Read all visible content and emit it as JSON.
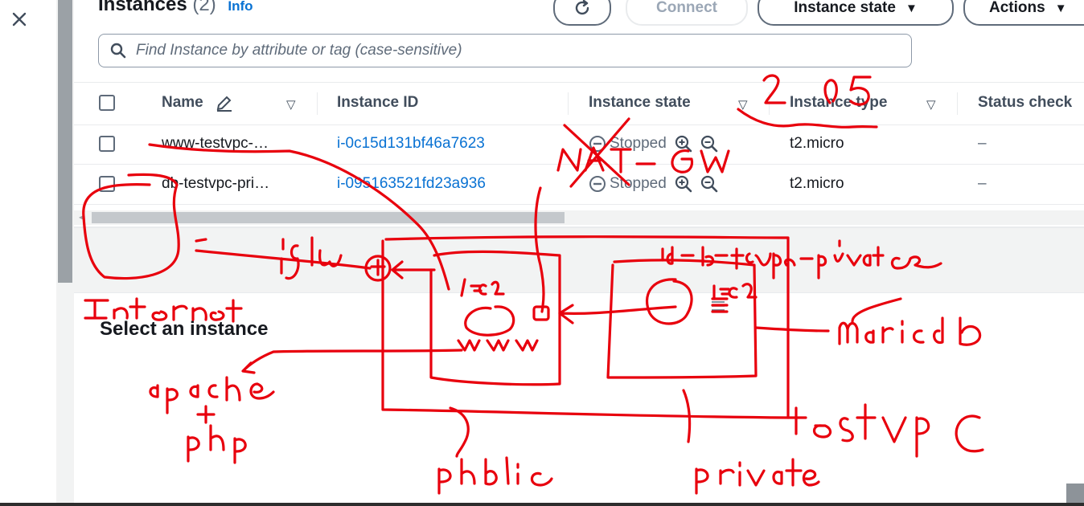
{
  "page": {
    "close_label": "Close panel",
    "title": "Instances",
    "count": "(2)",
    "info": "Info",
    "buttons": {
      "refresh": "Refresh",
      "connect": "Connect",
      "instance_state": "Instance state",
      "actions": "Actions"
    },
    "search_placeholder": "Find Instance by attribute or tag (case-sensitive)"
  },
  "table": {
    "columns": [
      "Name",
      "Instance ID",
      "Instance state",
      "Instance type",
      "Status check"
    ],
    "rows": [
      {
        "name": "www-testvpc-…",
        "id": "i-0c15d131bf46a7623",
        "state": "Stopped",
        "type": "t2.micro",
        "status": "–"
      },
      {
        "name": "db-testvpc-pri…",
        "id": "i-095163521fd23a936",
        "state": "Stopped",
        "type": "t2.micro",
        "status": "–"
      }
    ]
  },
  "details": {
    "title": "Select an instance"
  },
  "annotations": {
    "ink_color": "#e8000d",
    "texts": [
      "2.05",
      "NAT-GW",
      "igw",
      "Internet",
      "ec2",
      "www",
      "db-testvpc-private",
      "mariadb",
      "apache",
      "+",
      "php",
      "testvpc",
      "public",
      "private"
    ]
  },
  "colors": {
    "link": "#0972d3",
    "heading": "#16191f",
    "muted": "#5f6b7a"
  }
}
